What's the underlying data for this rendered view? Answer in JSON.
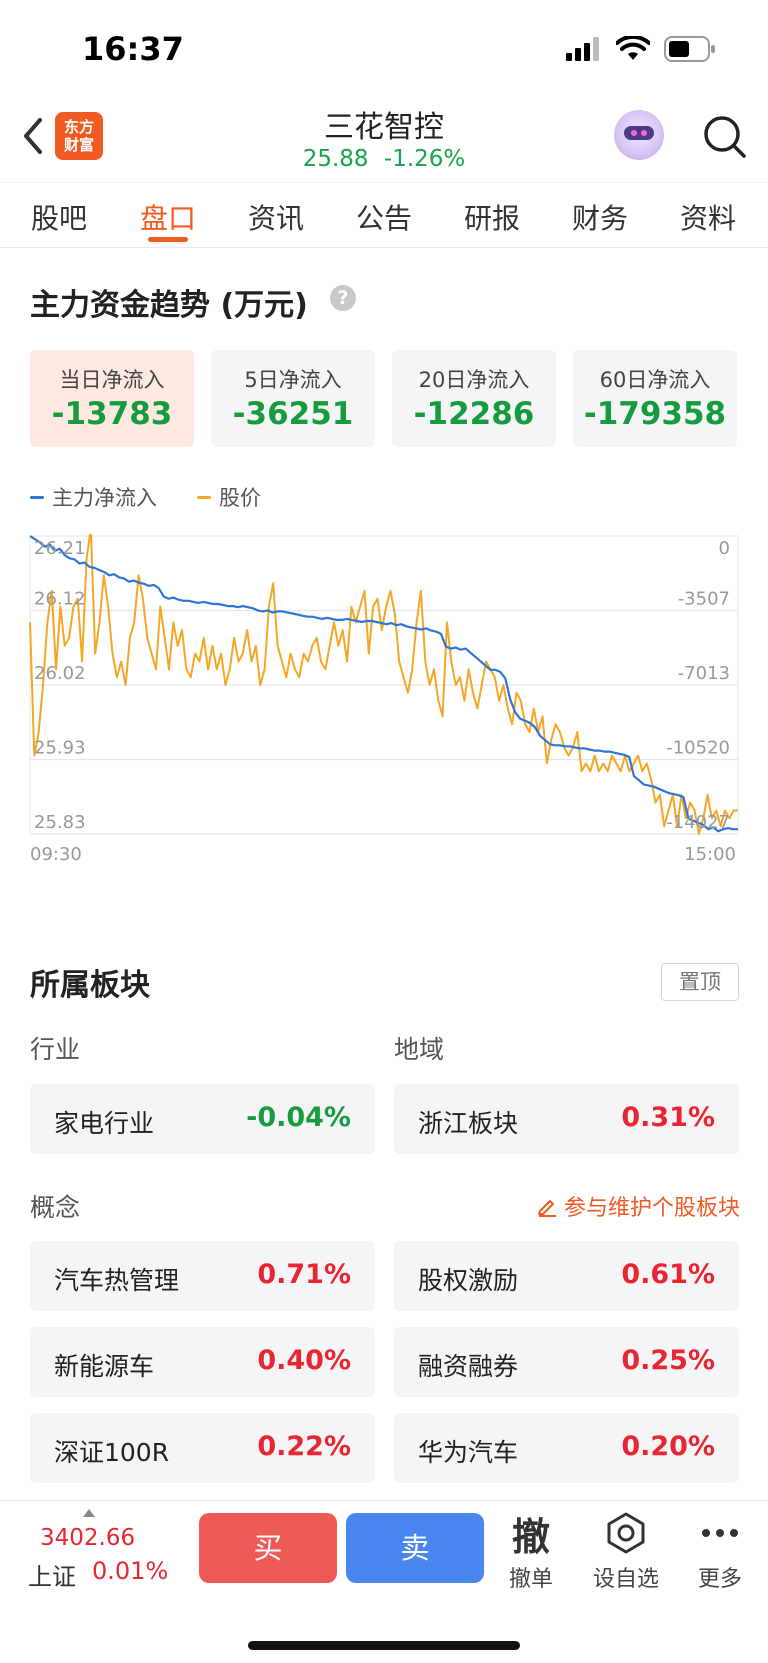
{
  "status_bar": {
    "time": "16:37"
  },
  "header": {
    "logo_text_line1": "东方",
    "logo_text_line2": "财富",
    "stock_name": "三花智控",
    "price": "25.88",
    "change_pct": "-1.26%"
  },
  "tabs": [
    {
      "label": "股吧",
      "active": false
    },
    {
      "label": "盘口",
      "active": true
    },
    {
      "label": "资讯",
      "active": false
    },
    {
      "label": "公告",
      "active": false
    },
    {
      "label": "研报",
      "active": false
    },
    {
      "label": "财务",
      "active": false
    },
    {
      "label": "资料",
      "active": false
    }
  ],
  "fund_flow": {
    "title": "主力资金趋势 (万元)",
    "help_icon": "?",
    "cards": [
      {
        "label": "当日净流入",
        "value": "-13783",
        "active": true
      },
      {
        "label": "5日净流入",
        "value": "-36251",
        "active": false
      },
      {
        "label": "20日净流入",
        "value": "-12286",
        "active": false
      },
      {
        "label": "60日净流入",
        "value": "-179358",
        "active": false
      }
    ],
    "legend": [
      {
        "name": "主力净流入",
        "color": "#2f74d8"
      },
      {
        "name": "股价",
        "color": "#f5a623"
      }
    ]
  },
  "chart_data": {
    "type": "line",
    "x_start": "09:30",
    "x_end": "15:00",
    "left_ticks": [
      "26.21",
      "26.12",
      "26.02",
      "25.93",
      "25.83"
    ],
    "right_ticks": [
      "0",
      "-3507",
      "-7013",
      "-10520",
      "-14027"
    ],
    "left_ylim": [
      25.83,
      26.21
    ],
    "right_ylim": [
      -14027,
      0
    ],
    "series": [
      {
        "name": "主力净流入",
        "axis": "right",
        "color": "#2f74d8",
        "values": [
          0,
          -150,
          -300,
          -500,
          -400,
          -700,
          -600,
          -900,
          -1050,
          -1100,
          -1300,
          -1250,
          -1450,
          -1500,
          -1600,
          -1700,
          -1850,
          -1800,
          -1950,
          -2000,
          -2150,
          -2100,
          -2200,
          -2250,
          -2350,
          -2300,
          -2450,
          -2850,
          -2950,
          -2900,
          -3000,
          -3050,
          -3050,
          -3100,
          -3150,
          -3100,
          -3150,
          -3200,
          -3200,
          -3250,
          -3300,
          -3300,
          -3350,
          -3300,
          -3350,
          -3400,
          -3500,
          -3550,
          -3500,
          -3600,
          -3550,
          -3550,
          -3600,
          -3650,
          -3700,
          -3750,
          -3800,
          -3800,
          -3850,
          -3900,
          -3850,
          -3900,
          -3950,
          -3950,
          -3900,
          -3950,
          -4000,
          -4050,
          -4000,
          -4000,
          -4050,
          -4100,
          -4150,
          -4100,
          -4200,
          -4150,
          -4250,
          -4300,
          -4350,
          -4400,
          -4350,
          -4450,
          -4500,
          -4600,
          -5200,
          -5300,
          -5250,
          -5350,
          -5300,
          -5500,
          -5700,
          -5900,
          -6100,
          -6300,
          -6300,
          -6400,
          -6700,
          -7700,
          -8300,
          -8600,
          -8700,
          -8800,
          -9000,
          -9400,
          -9600,
          -9800,
          -9850,
          -9850,
          -9900,
          -9900,
          -9950,
          -10000,
          -10000,
          -10050,
          -10100,
          -10100,
          -10150,
          -10150,
          -10200,
          -10250,
          -10300,
          -10400,
          -11300,
          -11500,
          -11700,
          -11750,
          -11800,
          -11900,
          -12000,
          -12100,
          -12150,
          -12200,
          -12300,
          -13300,
          -13400,
          -13500,
          -13600,
          -13800,
          -13700,
          -13900,
          -13800,
          -13750,
          -13800,
          -13800
        ]
      },
      {
        "name": "股价",
        "axis": "left",
        "color": "#f5a623",
        "values": [
          26.1,
          25.93,
          25.96,
          26.02,
          26.1,
          26.14,
          26.04,
          26.12,
          26.07,
          26.08,
          26.12,
          26.13,
          26.05,
          26.18,
          26.22,
          26.06,
          26.1,
          26.16,
          26.12,
          26.06,
          26.03,
          26.05,
          26.02,
          26.08,
          26.1,
          26.16,
          26.13,
          26.08,
          26.06,
          26.04,
          26.12,
          26.08,
          26.04,
          26.1,
          26.07,
          26.09,
          26.04,
          26.03,
          26.06,
          26.05,
          26.08,
          26.04,
          26.07,
          26.04,
          26.06,
          26.02,
          26.04,
          26.08,
          26.05,
          26.06,
          26.09,
          26.05,
          26.07,
          26.02,
          26.04,
          26.12,
          26.15,
          26.07,
          26.05,
          26.03,
          26.06,
          26.04,
          26.03,
          26.06,
          26.05,
          26.07,
          26.08,
          26.05,
          26.04,
          26.07,
          26.1,
          26.07,
          26.09,
          26.05,
          26.12,
          26.1,
          26.12,
          26.14,
          26.06,
          26.12,
          26.13,
          26.09,
          26.12,
          26.14,
          26.11,
          26.05,
          26.03,
          26.01,
          26.04,
          26.1,
          26.14,
          26.05,
          26.02,
          26.04,
          26.0,
          25.98,
          26.1,
          26.05,
          26.02,
          26.03,
          26.0,
          26.04,
          26.01,
          25.99,
          26.02,
          26.05,
          26.04,
          26.03,
          26.0,
          26.02,
          25.99,
          25.97,
          26.01,
          26.0,
          25.97,
          25.96,
          25.99,
          25.96,
          25.98,
          25.92,
          25.95,
          25.97,
          25.96,
          25.94,
          25.93,
          25.94,
          25.96,
          25.91,
          25.92,
          25.91,
          25.93,
          25.91,
          25.92,
          25.91,
          25.93,
          25.92,
          25.91,
          25.93,
          25.91,
          25.92,
          25.93,
          25.91,
          25.92,
          25.9,
          25.87,
          25.88,
          25.84,
          25.86,
          25.88,
          25.84,
          25.88,
          25.85,
          25.87,
          25.86,
          25.83,
          25.85,
          25.88,
          25.85,
          25.86,
          25.84,
          25.86,
          25.85,
          25.86,
          25.86
        ]
      }
    ]
  },
  "sectors": {
    "title": "所属板块",
    "pin_label": "置顶",
    "industry_label": "行业",
    "region_label": "地域",
    "concept_label": "概念",
    "maintain_link": "参与维护个股板块",
    "industry": {
      "name": "家电行业",
      "pct": "-0.04%"
    },
    "region": {
      "name": "浙江板块",
      "pct": "0.31%"
    },
    "concepts": [
      {
        "name": "汽车热管理",
        "pct": "0.71%"
      },
      {
        "name": "股权激励",
        "pct": "0.61%"
      },
      {
        "name": "新能源车",
        "pct": "0.40%"
      },
      {
        "name": "融资融券",
        "pct": "0.25%"
      },
      {
        "name": "深证100R",
        "pct": "0.22%"
      },
      {
        "name": "华为汽车",
        "pct": "0.20%"
      }
    ]
  },
  "bottom_bar": {
    "index_value": "3402.66",
    "index_name": "上证",
    "index_pct": "0.01%",
    "buy_label": "买",
    "sell_label": "卖",
    "cancel_icon_char": "撤",
    "cancel_label": "撤单",
    "watch_label": "设自选",
    "more_label": "更多"
  }
}
